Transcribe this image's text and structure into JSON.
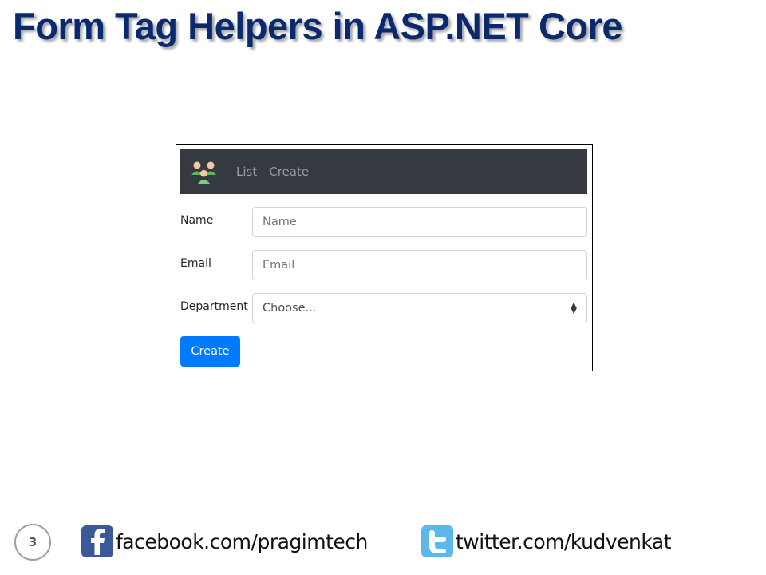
{
  "slide": {
    "title": "Form Tag Helpers in ASP.NET Core",
    "page_number": "3"
  },
  "navbar": {
    "logo_icon": "users-group-icon",
    "links": [
      {
        "label": "List"
      },
      {
        "label": "Create"
      }
    ]
  },
  "form": {
    "name": {
      "label": "Name",
      "placeholder": "Name",
      "value": ""
    },
    "email": {
      "label": "Email",
      "placeholder": "Email",
      "value": ""
    },
    "department": {
      "label": "Department",
      "selected": "Choose..."
    },
    "submit_label": "Create"
  },
  "footer": {
    "facebook": {
      "text": "facebook.com/pragimtech",
      "icon": "facebook-icon"
    },
    "twitter": {
      "text": "twitter.com/kudvenkat",
      "icon": "twitter-icon"
    }
  },
  "colors": {
    "title": "#0b2a6e",
    "navbar_bg": "#343a40",
    "primary_button": "#007bff",
    "facebook_blue": "#3b5998",
    "twitter_blue": "#5bb8e8"
  }
}
